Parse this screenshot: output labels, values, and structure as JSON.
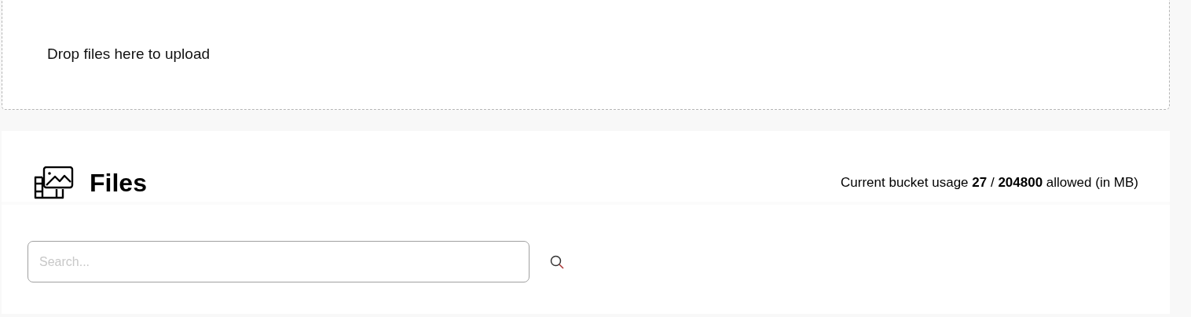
{
  "dropzone": {
    "text": "Drop files here to upload"
  },
  "files": {
    "title": "Files",
    "usage": "Current bucket usage **27** / **204800** allowed (in MB)"
  },
  "search": {
    "placeholder": "Search..."
  }
}
